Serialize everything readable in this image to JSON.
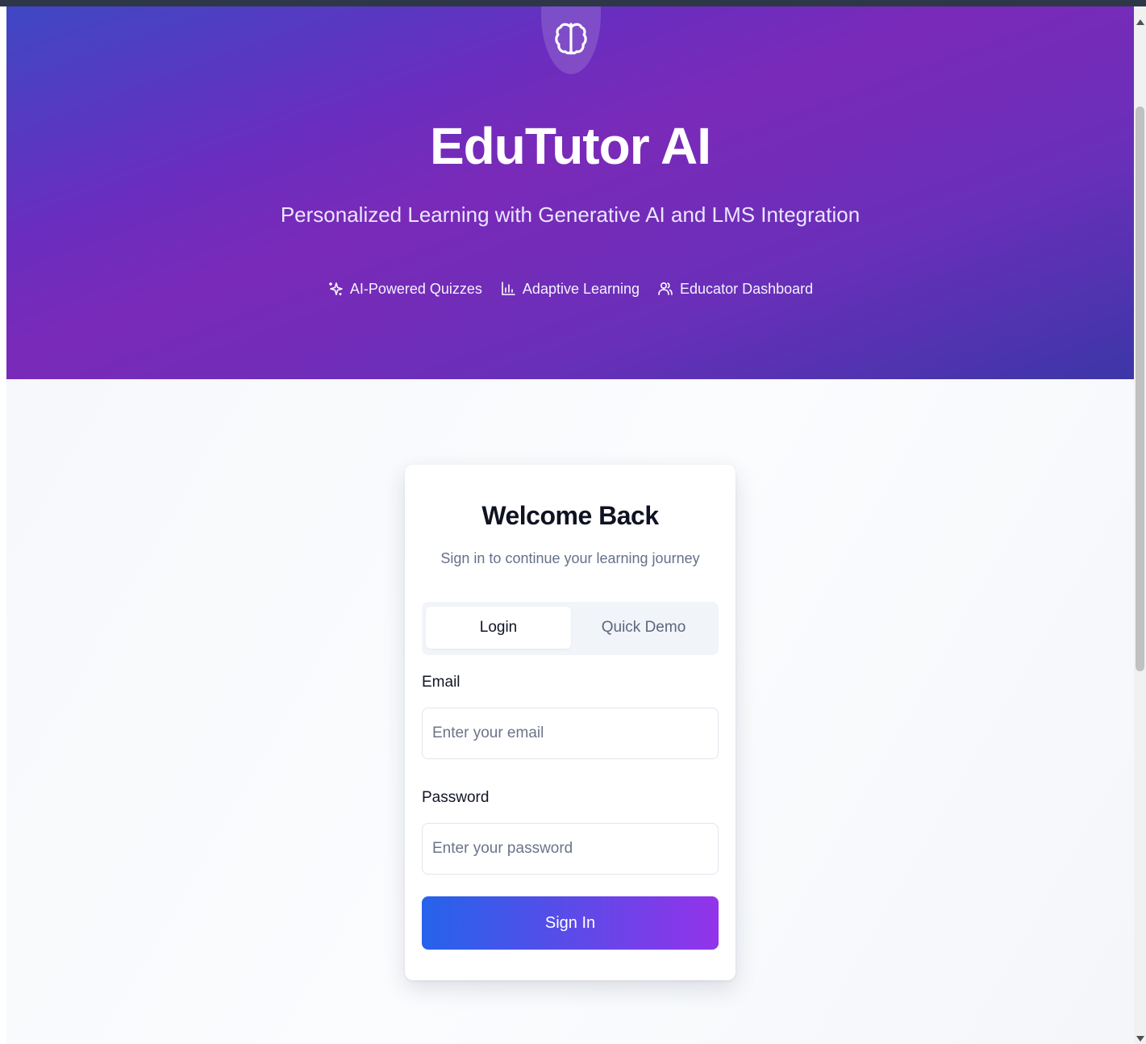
{
  "hero": {
    "logo_icon": "brain-icon",
    "title": "EduTutor AI",
    "subtitle": "Personalized Learning with Generative AI and LMS Integration",
    "features": [
      {
        "icon": "sparkles-icon",
        "label": "AI-Powered Quizzes"
      },
      {
        "icon": "bar-chart-icon",
        "label": "Adaptive Learning"
      },
      {
        "icon": "users-icon",
        "label": "Educator Dashboard"
      }
    ]
  },
  "login_card": {
    "title": "Welcome Back",
    "subtitle": "Sign in to continue your learning journey",
    "tabs": [
      {
        "label": "Login",
        "active": true
      },
      {
        "label": "Quick Demo",
        "active": false
      }
    ],
    "email": {
      "label": "Email",
      "placeholder": "Enter your email",
      "value": ""
    },
    "password": {
      "label": "Password",
      "placeholder": "Enter your password",
      "value": ""
    },
    "submit_label": "Sign In"
  },
  "colors": {
    "hero_gradient_start": "#3f48c4",
    "hero_gradient_mid": "#7a2ab8",
    "hero_gradient_end": "#3d36a8",
    "button_gradient_start": "#2563eb",
    "button_gradient_end": "#9333ea"
  }
}
